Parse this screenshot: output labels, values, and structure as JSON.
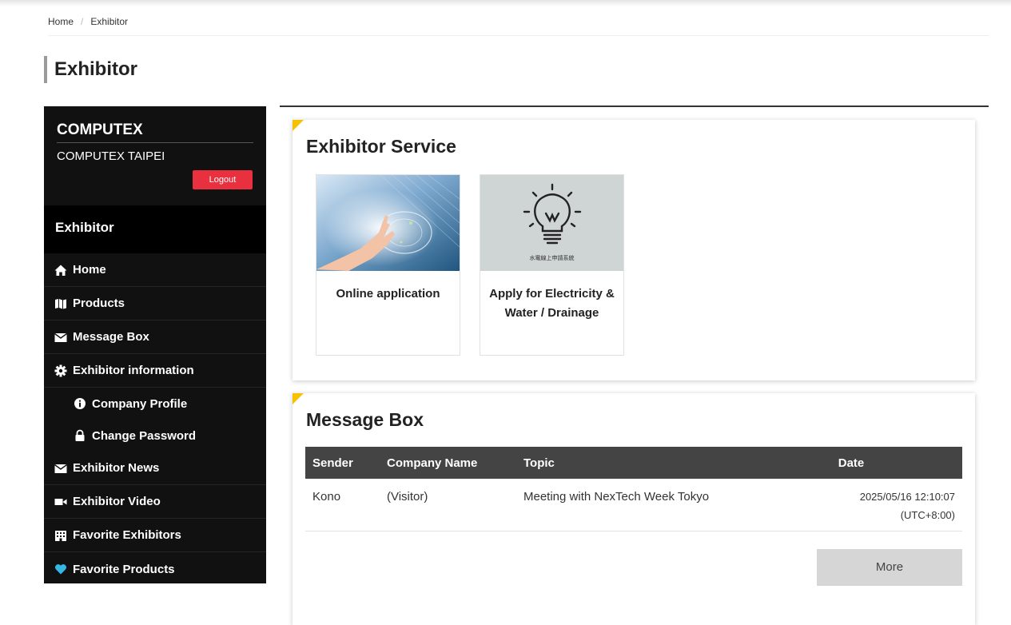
{
  "breadcrumb": {
    "home": "Home",
    "separator": "/",
    "current": "Exhibitor"
  },
  "page_title": "Exhibitor",
  "sidebar": {
    "brand": "COMPUTEX",
    "subtitle": "COMPUTEX TAIPEI",
    "logout_label": "Logout",
    "section_title": "Exhibitor",
    "items": [
      {
        "label": "Home",
        "icon": "home-icon"
      },
      {
        "label": "Products",
        "icon": "map-icon"
      },
      {
        "label": "Message Box",
        "icon": "envelope-icon"
      },
      {
        "label": "Exhibitor information",
        "icon": "gear-icon"
      },
      {
        "label": "Company Profile",
        "icon": "info-circle-icon",
        "sub": true
      },
      {
        "label": "Change Password",
        "icon": "lock-icon",
        "sub": true
      },
      {
        "label": "Exhibitor News",
        "icon": "envelope-icon"
      },
      {
        "label": "Exhibitor Video",
        "icon": "video-camera-icon"
      },
      {
        "label": "Favorite Exhibitors",
        "icon": "building-icon"
      },
      {
        "label": "Favorite Products",
        "icon": "heart-icon"
      }
    ]
  },
  "exhibitor_service": {
    "title": "Exhibitor Service",
    "cards": [
      {
        "label": "Online application",
        "image": "hand-touching-screen-image"
      },
      {
        "label": "Apply for Electricity & Water / Drainage",
        "image": "lightbulb-image",
        "image_caption": "水電線上申請系統"
      }
    ]
  },
  "message_box": {
    "title": "Message Box",
    "columns": [
      "Sender",
      "Company Name",
      "Topic",
      "Date"
    ],
    "rows": [
      {
        "sender": "Kono",
        "company": "(Visitor)",
        "topic": "Meeting with NexTech Week Tokyo",
        "date": "2025/05/16 12:10:07",
        "timezone": "(UTC+8:00)"
      }
    ],
    "more_label": "More"
  },
  "colors": {
    "accent_corner": "#f6c200",
    "logout": "#e8303e",
    "sidebar_bg": "#111111",
    "heart": "#35b8e6"
  }
}
